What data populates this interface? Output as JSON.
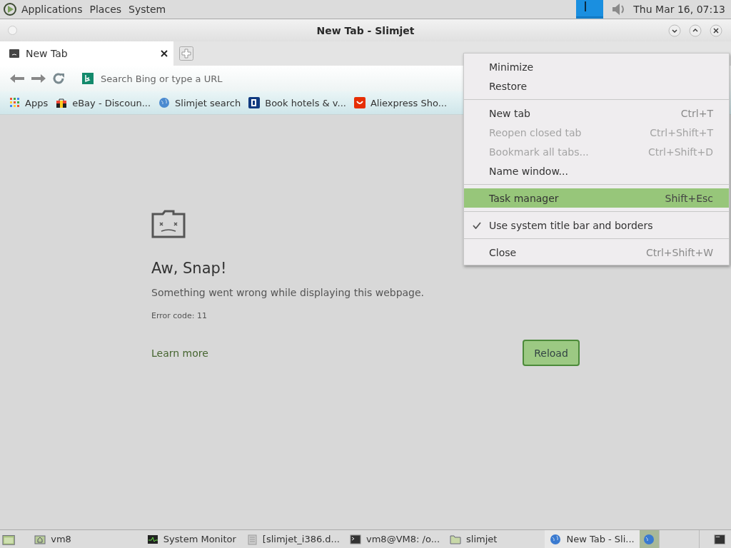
{
  "top_panel": {
    "menus": [
      "Applications",
      "Places",
      "System"
    ],
    "clock": "Thu Mar 16, 07:13"
  },
  "window": {
    "title": "New Tab - Slimjet"
  },
  "tabs": [
    {
      "label": "New Tab",
      "selected": true
    }
  ],
  "toolbar": {
    "omnibox": {
      "placeholder": "Search Bing or type a URL"
    }
  },
  "bookmarks": [
    {
      "label": "Apps"
    },
    {
      "label": "eBay - Discoun..."
    },
    {
      "label": "Slimjet search"
    },
    {
      "label": "Book hotels & v..."
    },
    {
      "label": "Aliexpress Sho..."
    }
  ],
  "error_page": {
    "title": "Aw, Snap!",
    "message": "Something went wrong while displaying this webpage.",
    "error_code": "Error code: 11",
    "learn_more": "Learn more",
    "reload": "Reload"
  },
  "menu": [
    {
      "kind": "item",
      "label": "Minimize",
      "disabled": false,
      "selected": false,
      "checked": false
    },
    {
      "kind": "item",
      "label": "Restore",
      "disabled": false,
      "selected": false,
      "checked": false
    },
    {
      "kind": "separator"
    },
    {
      "kind": "item",
      "label": "New tab",
      "shortcut": "Ctrl+T",
      "disabled": false,
      "selected": false,
      "checked": false
    },
    {
      "kind": "item",
      "label": "Reopen closed tab",
      "shortcut": "Ctrl+Shift+T",
      "disabled": true,
      "selected": false,
      "checked": false
    },
    {
      "kind": "item",
      "label": "Bookmark all tabs...",
      "shortcut": "Ctrl+Shift+D",
      "disabled": true,
      "selected": false,
      "checked": false
    },
    {
      "kind": "item",
      "label": "Name window...",
      "disabled": false,
      "selected": false,
      "checked": false
    },
    {
      "kind": "separator"
    },
    {
      "kind": "item",
      "label": "Task manager",
      "shortcut": "Shift+Esc",
      "disabled": false,
      "selected": true,
      "checked": false
    },
    {
      "kind": "separator"
    },
    {
      "kind": "item",
      "label": "Use system title bar and borders",
      "disabled": false,
      "selected": false,
      "checked": true
    },
    {
      "kind": "separator"
    },
    {
      "kind": "item",
      "label": "Close",
      "shortcut": "Ctrl+Shift+W",
      "disabled": false,
      "selected": false,
      "checked": false
    }
  ],
  "taskbar": [
    {
      "label": "vm8",
      "selected": false
    },
    {
      "label": "System Monitor",
      "selected": false
    },
    {
      "label": "[slimjet_i386.d...",
      "selected": false
    },
    {
      "label": "vm8@VM8: /o...",
      "selected": false
    },
    {
      "label": "slimjet",
      "selected": false
    },
    {
      "label": "New Tab - Sli...",
      "selected": true
    }
  ]
}
